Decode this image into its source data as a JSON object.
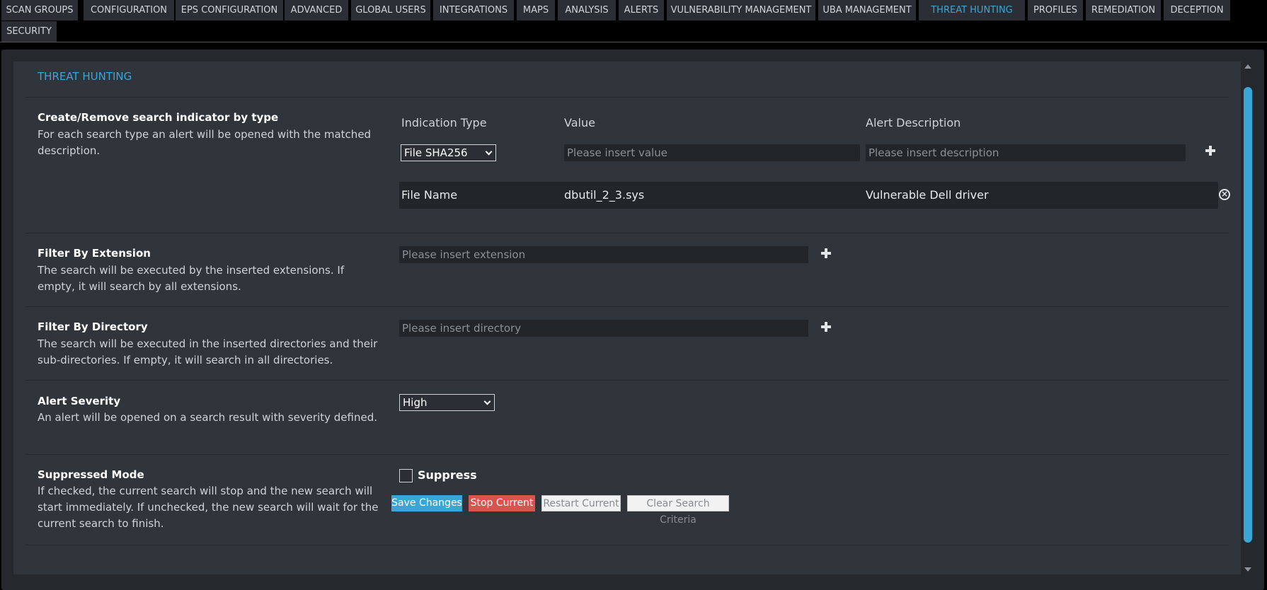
{
  "tabs": [
    {
      "label": "SCAN GROUPS",
      "active": false
    },
    {
      "label": "CONFIGURATION",
      "active": false
    },
    {
      "label": "EPS CONFIGURATION",
      "active": false
    },
    {
      "label": "ADVANCED",
      "active": false
    },
    {
      "label": "GLOBAL USERS",
      "active": false
    },
    {
      "label": "INTEGRATIONS",
      "active": false
    },
    {
      "label": "MAPS",
      "active": false
    },
    {
      "label": "ANALYSIS",
      "active": false
    },
    {
      "label": "ALERTS",
      "active": false
    },
    {
      "label": "VULNERABILITY MANAGEMENT",
      "active": false
    },
    {
      "label": "UBA MANAGEMENT",
      "active": false
    },
    {
      "label": "THREAT HUNTING",
      "active": true
    },
    {
      "label": "PROFILES",
      "active": false
    },
    {
      "label": "REMEDIATION",
      "active": false
    },
    {
      "label": "DECEPTION",
      "active": false
    },
    {
      "label": "SECURITY",
      "active": false
    }
  ],
  "section_title": "THREAT HUNTING",
  "indicator": {
    "label": "Create/Remove search indicator by type",
    "description": "For each search type an alert will be opened with the matched description.",
    "col_type": "Indication Type",
    "col_value": "Value",
    "col_desc": "Alert Description",
    "type_selected": "File SHA256",
    "value_placeholder": "Please insert value",
    "desc_placeholder": "Please insert description",
    "add_icon": "plus-icon",
    "rows": [
      {
        "type": "File Name",
        "value": "dbutil_2_3.sys",
        "description": "Vulnerable Dell driver",
        "remove_icon": "remove-circle-icon"
      }
    ]
  },
  "extension": {
    "label": "Filter By Extension",
    "description": "The search will be executed by the inserted extensions. If empty, it will search by all extensions.",
    "placeholder": "Please insert extension"
  },
  "directory": {
    "label": "Filter By Directory",
    "description": "The search will be executed in the inserted directories and their sub-directories. If empty, it will search in all directories.",
    "placeholder": "Please insert directory"
  },
  "severity": {
    "label": "Alert Severity",
    "description": "An alert will be opened on a search result with severity defined.",
    "selected": "High"
  },
  "suppressed": {
    "label": "Suppressed Mode",
    "description": "If checked, the current search will stop and the new search will start immediately. If unchecked, the new search will wait for the current search to finish.",
    "checkbox_label": "Suppress",
    "checked": false
  },
  "buttons": {
    "save": "Save Changes",
    "stop": "Stop Current",
    "restart": "Restart Current",
    "clear": "Clear Search Criteria"
  },
  "colors": {
    "accent": "#3aa6d6",
    "danger": "#d9534f",
    "panel": "#30353c"
  }
}
